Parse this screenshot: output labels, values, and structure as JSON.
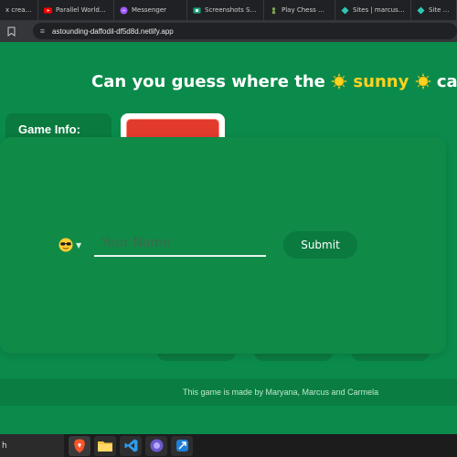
{
  "browser": {
    "tabs": [
      {
        "label": "x creatures",
        "color": "#888888"
      },
      {
        "label": "Parallel Worlds Pr",
        "color": "#ff0000"
      },
      {
        "label": "Messenger",
        "color": "#a259ff"
      },
      {
        "label": "Screenshots Saver",
        "color": "#1aa37a"
      },
      {
        "label": "Play Chess Online",
        "color": "#7fa650"
      },
      {
        "label": "Sites | marcusandy",
        "color": "#2ec7b3"
      },
      {
        "label": "Site overv",
        "color": "#2ec7b3"
      }
    ],
    "url": "astounding-daffodil-df5d8d.netlify.app"
  },
  "page": {
    "headline_before": "Can you guess where the",
    "headline_sunny": "sunny",
    "headline_after": "card",
    "game_info_label": "Game Info:",
    "footer_text": "This game is made by Maryana, Marcus and Carmela"
  },
  "modal": {
    "name_placeholder": "Your Name",
    "submit_label": "Submit",
    "emoji_icon": "sunglasses-face"
  },
  "taskbar": {
    "search_text": "h",
    "icons": [
      "brave-browser-icon",
      "file-explorer-icon",
      "vscode-icon",
      "browser-app-icon",
      "snipping-tool-icon"
    ]
  },
  "colors": {
    "page_bg": "#0b8b4b",
    "modal_bg": "#0f8a47",
    "sunny_text": "#ffd21f",
    "card_red": "#e23b2e"
  }
}
